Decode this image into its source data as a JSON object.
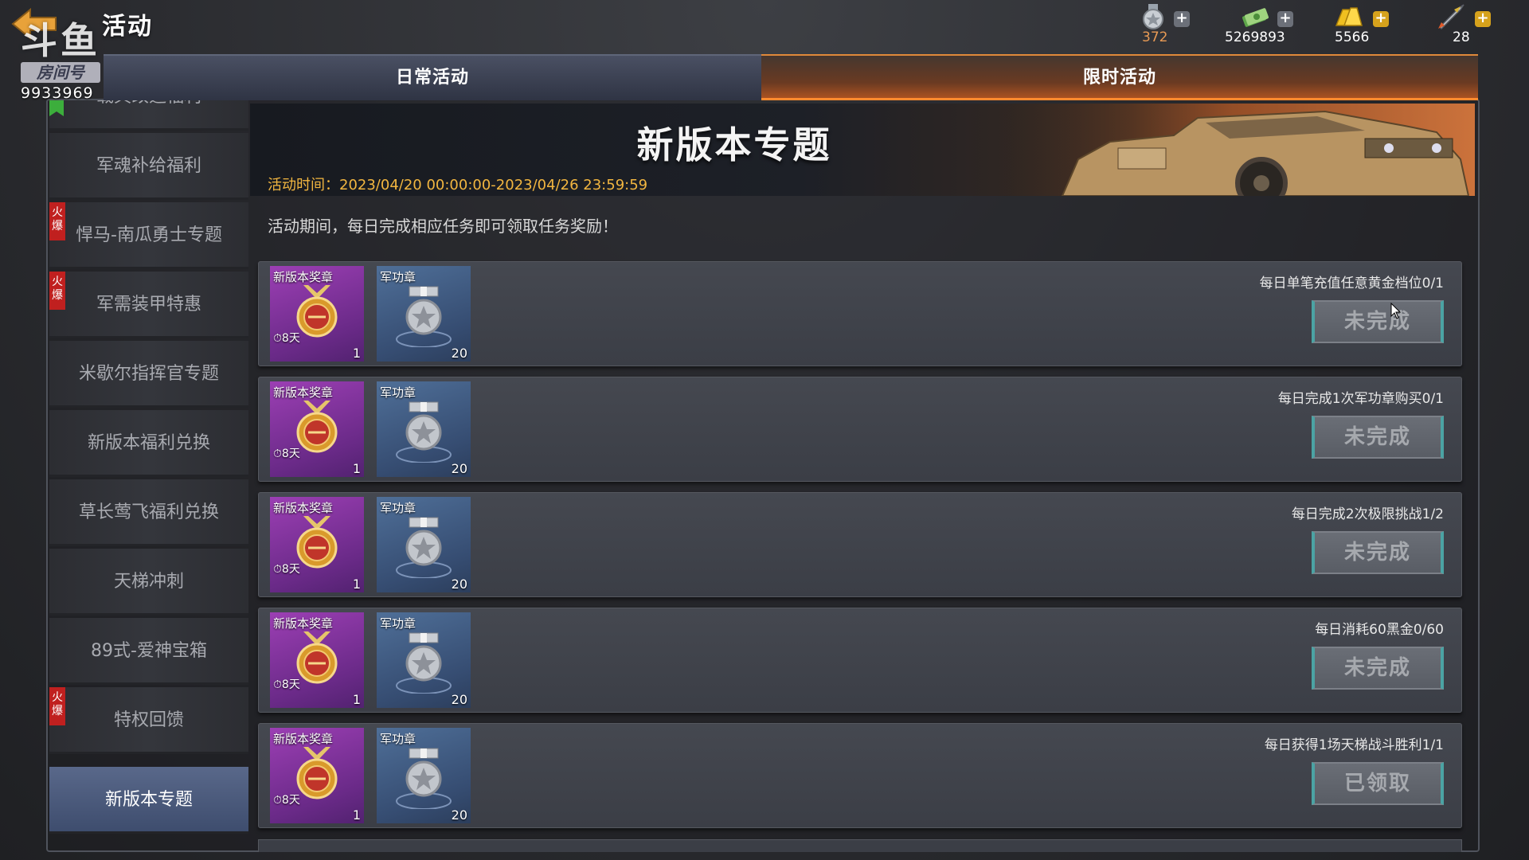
{
  "header": {
    "title": "活动",
    "currencies": [
      {
        "icon": "medal-currency-icon",
        "amount": "372",
        "color": "#e89a55"
      },
      {
        "icon": "cash-currency-icon",
        "amount": "5269893",
        "color": "#ffffff"
      },
      {
        "icon": "gold-currency-icon",
        "amount": "5566",
        "color": "#ffffff"
      },
      {
        "icon": "rocket-currency-icon",
        "amount": "28",
        "color": "#ffffff"
      }
    ]
  },
  "watermark": {
    "logo_text": "斗鱼",
    "room_label": "房间号",
    "room_number": "9933969"
  },
  "tabs": {
    "daily": "日常活动",
    "limited": "限时活动",
    "active": "limited"
  },
  "sidebar": {
    "items": [
      {
        "label": "载具改造福利",
        "hot": false
      },
      {
        "label": "军魂补给福利",
        "hot": false
      },
      {
        "label": "悍马-南瓜勇士专题",
        "hot": true
      },
      {
        "label": "军需装甲特惠",
        "hot": true
      },
      {
        "label": "米歇尔指挥官专题",
        "hot": false
      },
      {
        "label": "新版本福利兑换",
        "hot": false
      },
      {
        "label": "草长莺飞福利兑换",
        "hot": false
      },
      {
        "label": "天梯冲刺",
        "hot": false
      },
      {
        "label": "89式-爱神宝箱",
        "hot": false
      },
      {
        "label": "特权回馈",
        "hot": true
      },
      {
        "label": "新版本专题",
        "hot": false,
        "active": true
      }
    ],
    "hot_badge_text": "火爆"
  },
  "banner": {
    "title": "新版本专题",
    "time": "活动时间：2023/04/20 00:00:00-2023/04/26 23:59:59"
  },
  "description": "活动期间，每日完成相应任务即可领取任务奖励！",
  "tasks": [
    {
      "desc": "每日单笔充值任意黄金档位0/1",
      "button": "未完成",
      "rewards": [
        {
          "name": "新版本奖章",
          "count": "1",
          "time": "8天"
        },
        {
          "name": "军功章",
          "count": "20"
        }
      ]
    },
    {
      "desc": "每日完成1次军功章购买0/1",
      "button": "未完成",
      "rewards": [
        {
          "name": "新版本奖章",
          "count": "1",
          "time": "8天"
        },
        {
          "name": "军功章",
          "count": "20"
        }
      ]
    },
    {
      "desc": "每日完成2次极限挑战1/2",
      "button": "未完成",
      "rewards": [
        {
          "name": "新版本奖章",
          "count": "1",
          "time": "8天"
        },
        {
          "name": "军功章",
          "count": "20"
        }
      ]
    },
    {
      "desc": "每日消耗60黑金0/60",
      "button": "未完成",
      "rewards": [
        {
          "name": "新版本奖章",
          "count": "1",
          "time": "8天"
        },
        {
          "name": "军功章",
          "count": "20"
        }
      ]
    },
    {
      "desc": "每日获得1场天梯战斗胜利1/1",
      "button": "已领取",
      "rewards": [
        {
          "name": "新版本奖章",
          "count": "1",
          "time": "8天"
        },
        {
          "name": "军功章",
          "count": "20"
        }
      ]
    }
  ]
}
